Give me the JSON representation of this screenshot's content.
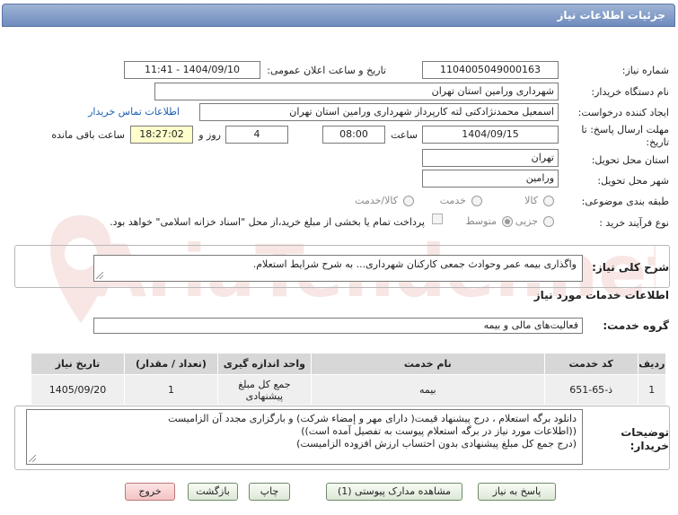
{
  "title": "جزئیات اطلاعات نیاز",
  "labels": {
    "need_number": "شماره نیاز:",
    "announce_datetime": "تاریخ و ساعت اعلان عمومی:",
    "buyer_org": "نام دستگاه خریدار:",
    "requester": "ایجاد کننده درخواست:",
    "deadline": "مهلت ارسال پاسخ: تا تاریخ:",
    "time": "ساعت",
    "day_and": "روز و",
    "remaining": "ساعت باقی مانده",
    "province": "استان محل تحویل:",
    "city": "شهر محل تحویل:",
    "category": "طبقه بندی موضوعی:",
    "purchase_type": "نوع فرآیند خرید :",
    "description": "شرح کلی نیاز:",
    "services_info": "اطلاعات خدمات مورد نیاز",
    "service_group": "گروه خدمت:",
    "buyer_notes": "توضیحات خریدار:"
  },
  "values": {
    "need_number": "1104005049000163",
    "announce_datetime": "1404/09/10 - 11:41",
    "buyer_org": "شهرداری ورامین استان تهران",
    "requester": "اسمعیل محمدنژادکتی لته کارپرداز شهرداری ورامین استان تهران",
    "deadline_date": "1404/09/15",
    "deadline_time": "08:00",
    "days": "4",
    "remaining_time": "18:27:02",
    "province": "تهران",
    "city": "ورامین",
    "description": "واگذاری بیمه عمر وحوادث جمعی کارکنان شهرداری... به شرح شرایط استعلام.",
    "service_group": "فعالیت‌های مالی و بیمه",
    "buyer_notes_1": "دانلود برگه استعلام ، درج پیشنهاد قیمت( دارای مهر و إمضاء شرکت) و بارگزاری مجدد آن الزامیست",
    "buyer_notes_2": "((اطلاعات مورد نیاز در برگه استعلام پیوست به تفصیل آمده است))",
    "buyer_notes_3": "(درج  جمع کل مبلغ پیشنهادی بدون احتساب ارزش افزوده الزامیست)"
  },
  "contact_link": "اطلاعات تماس خریدار",
  "category_options": [
    "کالا",
    "خدمت",
    "کالا/خدمت"
  ],
  "purchase_options": [
    "جزیی",
    "متوسط"
  ],
  "payment_note": "پرداخت تمام یا بخشی از مبلغ خرید،از محل \"اسناد خزانه اسلامی\" خواهد بود.",
  "table": {
    "headers": [
      "ردیف",
      "کد خدمت",
      "نام خدمت",
      "واحد اندازه گیری",
      "(تعداد / مقدار)",
      "تاریخ نیاز"
    ],
    "rows": [
      [
        "1",
        "ذ-65-651",
        "بیمه",
        "جمع کل مبلغ پیشنهادی",
        "1",
        "1405/09/20"
      ]
    ]
  },
  "buttons": {
    "reply": "پاسخ به نیاز",
    "attachments": "مشاهده مدارک پیوستی (1)",
    "print": "چاپ",
    "back": "بازگشت",
    "exit": "خروج"
  },
  "watermark_text": "AriaTender.net",
  "colors": {
    "title_bar": "#7f99c6",
    "link": "#1a5fb4",
    "remaining_bg": "#ffffcc",
    "exit_button": "#f3c3c3"
  }
}
